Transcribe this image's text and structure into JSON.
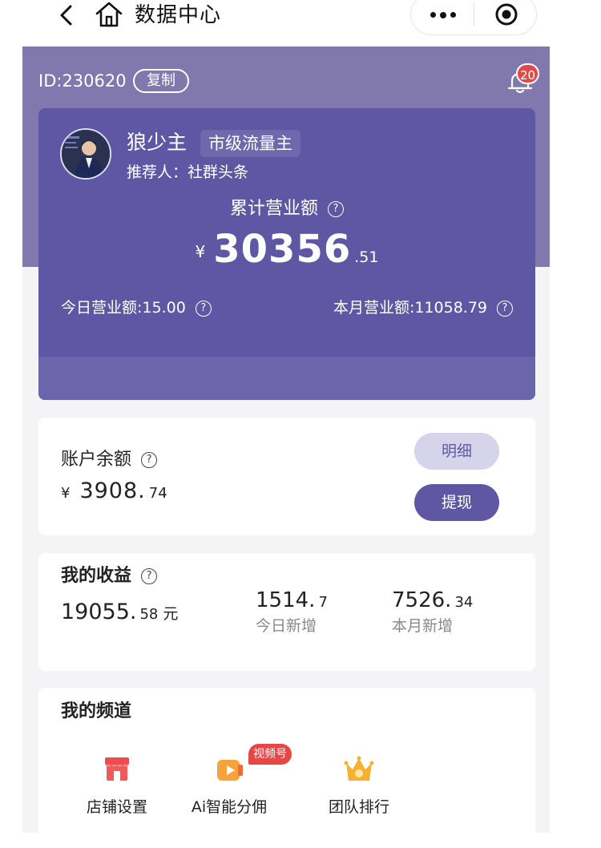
{
  "navbar": {
    "title": "数据中心"
  },
  "account": {
    "id_text": "ID:230620",
    "copy_label": "复制",
    "notification_count": "20"
  },
  "profile": {
    "name": "狼少主",
    "level_tag": "市级流量主",
    "referrer": "推荐人：社群头条"
  },
  "revenue": {
    "total_label": "累计营业额",
    "currency": "¥",
    "total_int": "30356",
    "total_dec": ".51",
    "today_text": "今日营业额:15.00",
    "month_text": "本月营业额:11058.79"
  },
  "balance": {
    "title": "账户余额",
    "currency": "¥",
    "amount_int": "3908.",
    "amount_dec": "74",
    "detail_label": "明细",
    "withdraw_label": "提现"
  },
  "income": {
    "title": "我的收益",
    "total_int": "19055.",
    "total_dec": "58",
    "unit": "元",
    "today_int": "1514.",
    "today_dec": "7",
    "today_label": "今日新增",
    "month_int": "7526.",
    "month_dec": "34",
    "month_label": "本月新增"
  },
  "channels": {
    "title": "我的频道",
    "video_tag": "视频号",
    "items": [
      {
        "label": "店铺设置",
        "icon": "store-icon"
      },
      {
        "label": "Ai智能分佣",
        "icon": "video-icon"
      },
      {
        "label": "团队排行",
        "icon": "crown-icon"
      }
    ]
  },
  "colors": {
    "purple_bg": "#8179ad",
    "card_purple": "#5f57a3",
    "light_purple_button": "#d6d4ea",
    "badge_red": "#e24a4a"
  }
}
